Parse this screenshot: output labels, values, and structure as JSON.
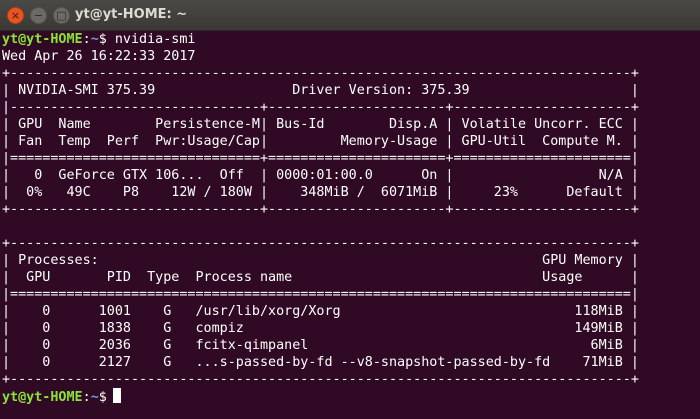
{
  "window": {
    "title": "yt@yt-HOME: ~",
    "close_glyph": "×",
    "minimize_glyph": "−",
    "maximize_glyph": "□"
  },
  "colors": {
    "background": "#300a24",
    "prompt_user": "#8ae234",
    "prompt_path": "#729fcf",
    "text": "#ffffff"
  },
  "terminal": {
    "prompt": {
      "user_host": "yt@yt-HOME",
      "colon": ":",
      "path": "~",
      "symbol": "$"
    },
    "command": " nvidia-smi",
    "output": [
      "Wed Apr 26 16:22:33 2017",
      "+-----------------------------------------------------------------------------+",
      "| NVIDIA-SMI 375.39                 Driver Version: 375.39                    |",
      "|-------------------------------+----------------------+----------------------+",
      "| GPU  Name        Persistence-M| Bus-Id        Disp.A | Volatile Uncorr. ECC |",
      "| Fan  Temp  Perf  Pwr:Usage/Cap|         Memory-Usage | GPU-Util  Compute M. |",
      "|===============================+======================+======================|",
      "|   0  GeForce GTX 106...  Off  | 0000:01:00.0      On |                  N/A |",
      "|  0%   49C    P8    12W / 180W |    348MiB /  6071MiB |     23%      Default |",
      "+-------------------------------+----------------------+----------------------+",
      "",
      "+-----------------------------------------------------------------------------+",
      "| Processes:                                                       GPU Memory |",
      "|  GPU       PID  Type  Process name                               Usage      |",
      "|=============================================================================|",
      "|    0      1001    G   /usr/lib/xorg/Xorg                             118MiB |",
      "|    0      1838    G   compiz                                         149MiB |",
      "|    0      2036    G   fcitx-qimpanel                                   6MiB |",
      "|    0      2127    G   ...s-passed-by-fd --v8-snapshot-passed-by-fd    71MiB |",
      "+-----------------------------------------------------------------------------+"
    ]
  }
}
